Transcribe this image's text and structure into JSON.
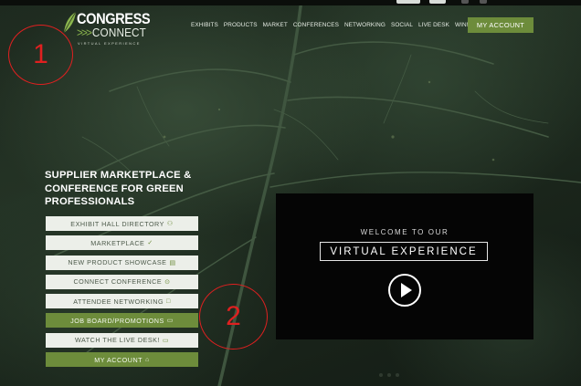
{
  "logo": {
    "line1": "CONGRESS",
    "line2_chevrons": ">>>",
    "line2": "CONNECT",
    "line3": "VIRTUAL EXPERIENCE",
    "accent_color": "#8bb64e"
  },
  "nav": {
    "items": [
      "EXHIBITS",
      "PRODUCTS",
      "MARKET",
      "CONFERENCES",
      "NETWORKING",
      "SOCIAL",
      "LIVE DESK",
      "WIN!"
    ],
    "account_label": "MY ACCOUNT"
  },
  "annotations": {
    "first": "1",
    "second": "2"
  },
  "hero": {
    "headline": "SUPPLIER MARKETPLACE & CONFERENCE FOR GREEN PROFESSIONALS"
  },
  "menu": {
    "items": [
      {
        "label": "EXHIBIT HALL DIRECTORY",
        "icon": "people-icon",
        "glyph": "⚇"
      },
      {
        "label": "MARKETPLACE",
        "icon": "check-icon",
        "glyph": "✓"
      },
      {
        "label": "NEW PRODUCT SHOWCASE",
        "icon": "showcase-icon",
        "glyph": "▤"
      },
      {
        "label": "CONNECT CONFERENCE",
        "icon": "play-circle-icon",
        "glyph": "⊙"
      },
      {
        "label": "ATTENDEE NETWORKING",
        "icon": "chat-icon",
        "glyph": "□"
      },
      {
        "label": "JOB BOARD/PROMOTIONS",
        "icon": "message-icon",
        "glyph": "▭"
      },
      {
        "label": "WATCH THE LIVE DESK!",
        "icon": "video-icon",
        "glyph": "▭"
      },
      {
        "label": "MY ACCOUNT",
        "icon": "lock-icon",
        "glyph": "⌂"
      }
    ]
  },
  "video": {
    "kicker": "WELCOME TO OUR",
    "title": "VIRTUAL EXPERIENCE",
    "play_icon": "play-icon"
  },
  "colors": {
    "brand_green": "#6d8c3b",
    "annotation_red": "#e02020"
  }
}
